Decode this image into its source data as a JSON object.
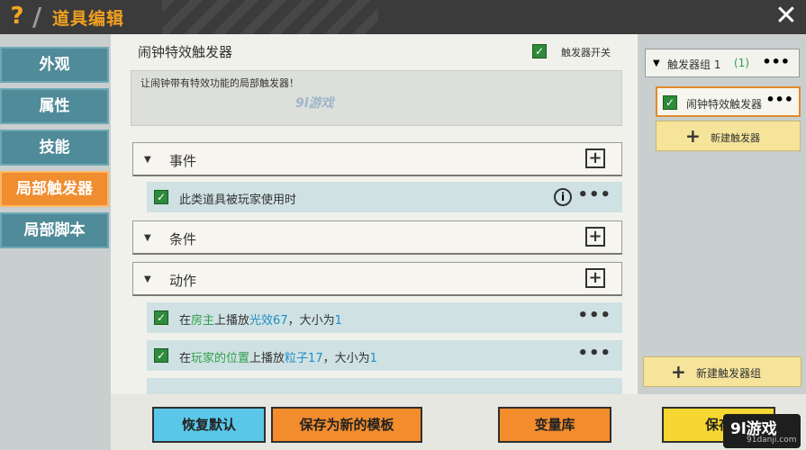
{
  "header": {
    "help": "?",
    "title": "道具编辑",
    "close": "✕"
  },
  "leftnav": {
    "items": [
      {
        "label": "外观"
      },
      {
        "label": "属性"
      },
      {
        "label": "技能"
      },
      {
        "label": "局部触发器",
        "active": true
      },
      {
        "label": "局部脚本"
      }
    ]
  },
  "center": {
    "title": "闹钟特效触发器",
    "switch_label": "触发器开关",
    "switch_checked": true,
    "description": "让闹钟带有特效功能的局部触发器！",
    "sections": {
      "event": {
        "label": "事件"
      },
      "condition": {
        "label": "条件"
      },
      "action": {
        "label": "动作"
      }
    },
    "event_rows": [
      {
        "text": "此类道具被玩家使用时"
      }
    ],
    "action_rows": [
      {
        "p1": "在",
        "h1": "房主",
        "p2": "上播放",
        "h2": "光效67",
        "p3": "，大小为",
        "h3": "1"
      },
      {
        "p1": "在",
        "h1": "玩家的位置",
        "p2": "上播放",
        "h2": "粒子17",
        "p3": "，大小为",
        "h3": "1"
      }
    ]
  },
  "rightpanel": {
    "group_name": "触发器组 1",
    "group_count": "(1)",
    "trigger_name": "闹钟特效触发器",
    "new_trigger": "新建触发器",
    "new_group": "新建触发器组"
  },
  "bottombar": {
    "reset": "恢复默认",
    "save_template": "保存为新的模板",
    "variables": "变量库",
    "save": "保存"
  },
  "watermark": {
    "center": "9l游戏",
    "logo_main": "9l游戏",
    "logo_url": "91danji.com"
  },
  "colors": {
    "accent": "#f08d2f",
    "nav": "#4f8b98",
    "reset": "#5ac7e8",
    "save": "#f6d630"
  }
}
